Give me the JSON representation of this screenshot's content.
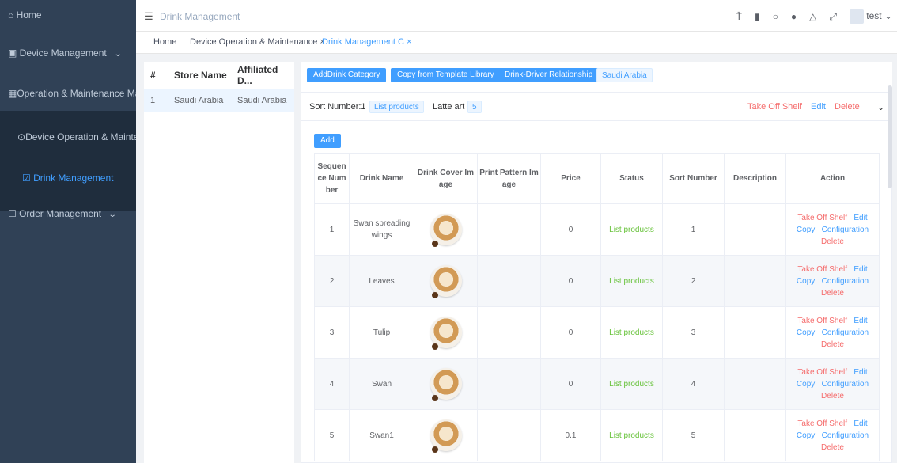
{
  "sidebar": {
    "home": "Home",
    "device_management": "Device Management",
    "om_management": "Operation & Maintenance Mar",
    "device_operation": "Device Operation & Mainte",
    "drink_management": "Drink Management",
    "order_management": "Order Management"
  },
  "topbar": {
    "title": "Drink Management",
    "user": "test"
  },
  "tags": {
    "home": "Home",
    "device_op": "Device Operation & Maintenance",
    "drink_mgmt": "Drink Management"
  },
  "store_table": {
    "headers": [
      "#",
      "Store Name",
      "Affiliated D..."
    ],
    "rows": [
      [
        "1",
        "Saudi Arabia",
        "Saudi Arabia"
      ]
    ]
  },
  "actions": {
    "add_category": "AddDrink Category",
    "copy_template": "Copy from Template Library",
    "driver_relationship": "Drink-Driver Relationship",
    "country": "Saudi Arabia"
  },
  "category": {
    "sort_label": "Sort Number:1",
    "status": "List products",
    "name": "Latte art",
    "count": "5",
    "take_off": "Take Off Shelf",
    "edit": "Edit",
    "delete": "Delete"
  },
  "add_label": "Add",
  "drink_table": {
    "headers": [
      "Sequence Number",
      "Drink Name",
      "Drink Cover Image",
      "Print Pattern Image",
      "Price",
      "Status",
      "Sort Number",
      "Description",
      "Action"
    ],
    "rows": [
      {
        "seq": "1",
        "name": "Swan spreading wings",
        "price": "0",
        "status": "List products",
        "sort": "1",
        "desc": ""
      },
      {
        "seq": "2",
        "name": "Leaves",
        "price": "0",
        "status": "List products",
        "sort": "2",
        "desc": ""
      },
      {
        "seq": "3",
        "name": "Tulip",
        "price": "0",
        "status": "List products",
        "sort": "3",
        "desc": ""
      },
      {
        "seq": "4",
        "name": "Swan",
        "price": "0",
        "status": "List products",
        "sort": "4",
        "desc": ""
      },
      {
        "seq": "5",
        "name": "Swan1",
        "price": "0.1",
        "status": "List products",
        "sort": "5",
        "desc": ""
      }
    ],
    "row_actions": {
      "take_off": "Take Off Shelf",
      "edit": "Edit",
      "copy": "Copy",
      "config": "Configuration",
      "delete": "Delete"
    }
  },
  "colors": {
    "sidebar": "#304156",
    "accent": "#409eff",
    "danger": "#f56c6c",
    "success": "#67c23a"
  }
}
